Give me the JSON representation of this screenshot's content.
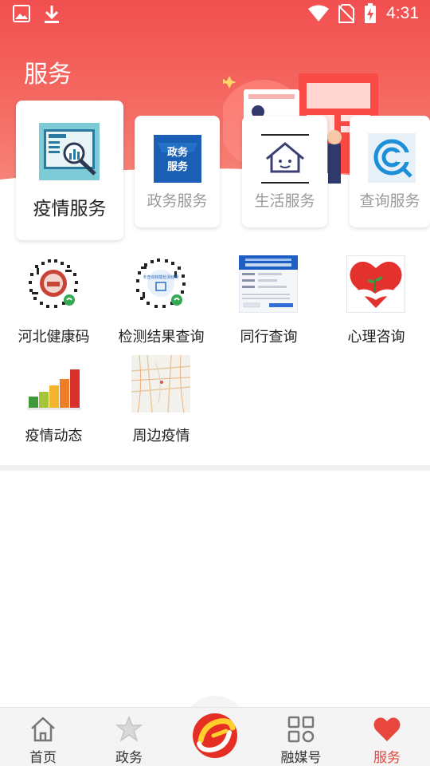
{
  "status_bar": {
    "time": "4:31",
    "left_icons": [
      "image-icon",
      "download-icon"
    ],
    "right_icons": [
      "wifi-icon",
      "no-sim-icon",
      "battery-charging-icon"
    ]
  },
  "header": {
    "title": "服务"
  },
  "categories": [
    {
      "label": "疫情服务",
      "active": true,
      "icon": "epidemic-monitor-icon"
    },
    {
      "label": "政务服务",
      "active": false,
      "icon": "gov-service-icon"
    },
    {
      "label": "生活服务",
      "active": false,
      "icon": "life-house-icon"
    },
    {
      "label": "查询服务",
      "active": false,
      "icon": "query-logo-icon"
    }
  ],
  "grid": [
    {
      "label": "河北健康码",
      "icon": "health-code-qr-icon"
    },
    {
      "label": "检测结果查询",
      "icon": "test-result-qr-icon"
    },
    {
      "label": "同行查询",
      "icon": "companion-query-screenshot"
    },
    {
      "label": "心理咨询",
      "icon": "heart-hands-icon"
    },
    {
      "label": "疫情动态",
      "icon": "bar-chart-icon"
    },
    {
      "label": "周边疫情",
      "icon": "map-icon"
    }
  ],
  "qr_texts": {
    "test_result": "冬查询核酸检测结果"
  },
  "bottom_nav": {
    "items": [
      {
        "label": "首页",
        "icon": "home-icon",
        "active": false
      },
      {
        "label": "政务",
        "icon": "star-icon",
        "active": false
      },
      {
        "label": "",
        "icon": "center-logo-icon",
        "active": false
      },
      {
        "label": "融媒号",
        "icon": "grid-icon",
        "active": false
      },
      {
        "label": "服务",
        "icon": "heart-icon",
        "active": true
      }
    ]
  },
  "colors": {
    "brand_red": "#f14f4f",
    "active_tab": "#e8473d",
    "label_gray": "#9a9a9a"
  }
}
